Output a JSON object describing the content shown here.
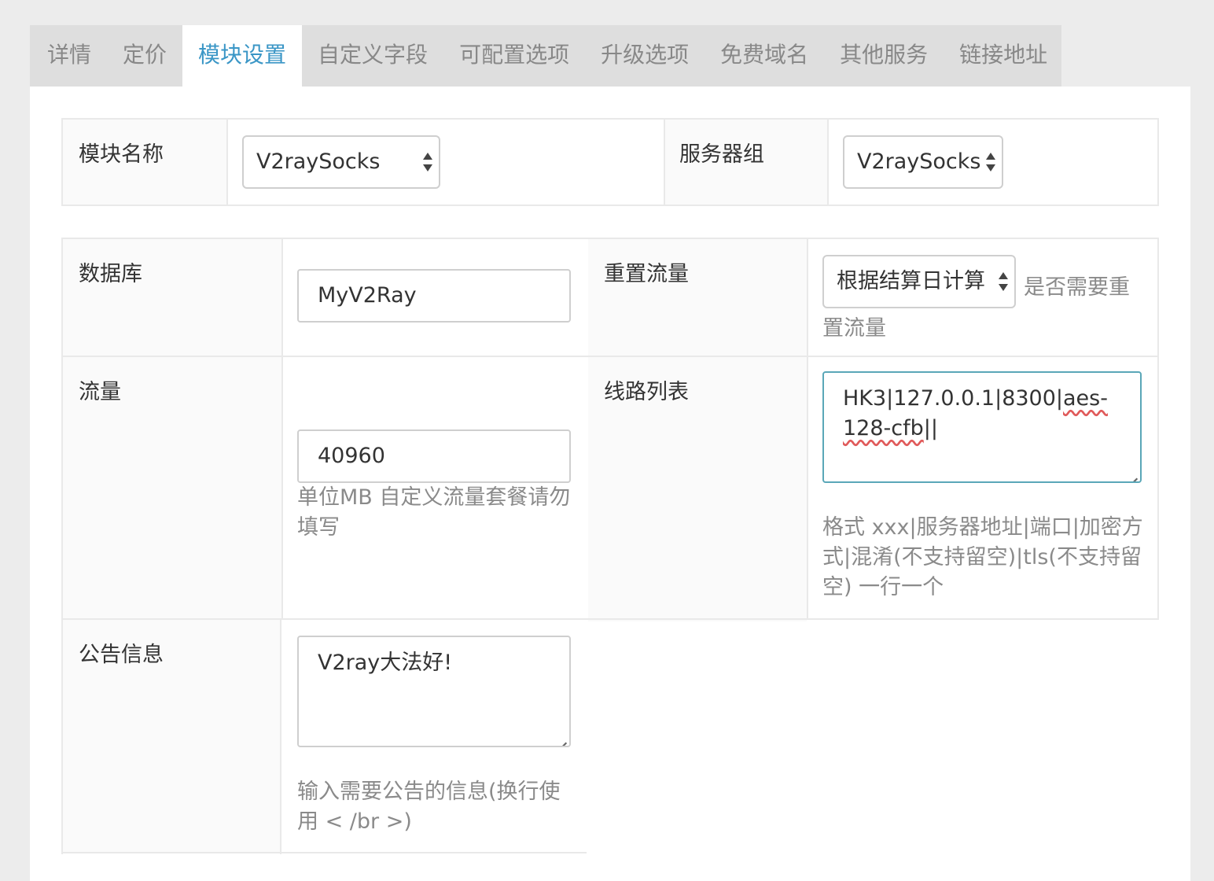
{
  "tabs": [
    {
      "label": "详情",
      "active": false
    },
    {
      "label": "定价",
      "active": false
    },
    {
      "label": "模块设置",
      "active": true
    },
    {
      "label": "自定义字段",
      "active": false
    },
    {
      "label": "可配置选项",
      "active": false
    },
    {
      "label": "升级选项",
      "active": false
    },
    {
      "label": "免费域名",
      "active": false
    },
    {
      "label": "其他服务",
      "active": false
    },
    {
      "label": "链接地址",
      "active": false
    }
  ],
  "module": {
    "name_label": "模块名称",
    "name_value": "V2raySocks",
    "server_group_label": "服务器组",
    "server_group_value": "V2raySocks"
  },
  "settings": {
    "database_label": "数据库",
    "database_value": "MyV2Ray",
    "reset_label": "重置流量",
    "reset_value": "根据结算日计算",
    "reset_help": "是否需要重置流量",
    "traffic_label": "流量",
    "traffic_value": "40960",
    "traffic_help": "单位MB 自定义流量套餐请勿填写",
    "routes_label": "线路列表",
    "routes_value_a": "HK3|127.0.0.1|8300|",
    "routes_value_b": "aes-128-cfb",
    "routes_value_c": "||",
    "routes_help": "格式 xxx|服务器地址|端口|加密方式|混淆(不支持留空)|tls(不支持留空) 一行一个",
    "notice_label": "公告信息",
    "notice_value": "V2ray大法好!",
    "notice_help": "输入需要公告的信息(换行使用 < /br >)"
  },
  "colors": {
    "accent": "#3a96c6",
    "focus_border": "#5aa7b8"
  }
}
